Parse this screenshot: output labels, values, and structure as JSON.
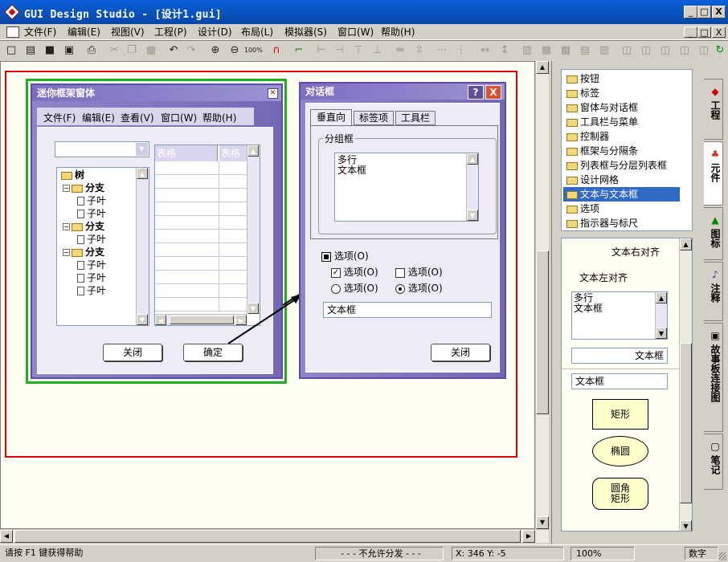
{
  "window": {
    "title": "GUI Design Studio - [设计1.gui]",
    "min": "_",
    "max": "□",
    "close": "X"
  },
  "menu": [
    "文件(F)",
    "编辑(E)",
    "视图(V)",
    "工程(P)",
    "设计(D)",
    "布局(L)",
    "模拟器(S)",
    "窗口(W)",
    "帮助(H)"
  ],
  "toolbar": {
    "zoom_label": "100%"
  },
  "mini_frame": {
    "title": "迷你框架窗体",
    "menu": [
      "文件(F)",
      "编辑(E)",
      "查看(V)",
      "窗口(W)",
      "帮助(H)"
    ],
    "combo": "组合框",
    "tree": [
      {
        "label": "树",
        "level": 0,
        "kind": "root"
      },
      {
        "label": "分支",
        "level": 1,
        "kind": "branch"
      },
      {
        "label": "子叶",
        "level": 2,
        "kind": "leaf"
      },
      {
        "label": "子叶",
        "level": 2,
        "kind": "leaf"
      },
      {
        "label": "分支",
        "level": 1,
        "kind": "branch"
      },
      {
        "label": "子叶",
        "level": 2,
        "kind": "leaf"
      },
      {
        "label": "分支",
        "level": 1,
        "kind": "branch"
      },
      {
        "label": "子叶",
        "level": 2,
        "kind": "leaf"
      },
      {
        "label": "子叶",
        "level": 2,
        "kind": "leaf"
      },
      {
        "label": "子叶",
        "level": 2,
        "kind": "leaf"
      }
    ],
    "table_headers": [
      "表格",
      "表格"
    ],
    "close_btn": "关闭",
    "ok_btn": "确定"
  },
  "dialog": {
    "title": "对话框",
    "help": "?",
    "close": "X",
    "tabs": [
      "垂直向",
      "标签项",
      "工具栏"
    ],
    "group_label": "分组框",
    "multiline": [
      "多行",
      "文本框"
    ],
    "option_main": "选项(O)",
    "check1": "选项(O)",
    "check2": "选项(O)",
    "radio1": "选项(O)",
    "radio2": "选项(O)",
    "textbox": "文本框",
    "close_btn": "关闭"
  },
  "components": [
    "按钮",
    "标签",
    "窗体与对话框",
    "工具栏与菜单",
    "控制器",
    "框架与分隔条",
    "列表框与分层列表框",
    "设计网格",
    "文本与文本框",
    "选项",
    "指示器与标尺"
  ],
  "selected_component": "文本与文本框",
  "preview": {
    "right_align": "文本右对齐",
    "left_align": "文本左对齐",
    "multiline": [
      "多行",
      "文本框"
    ],
    "textbox_right": "文本框",
    "textbox_left": "文本框",
    "rect": "矩形",
    "ellipse": "椭圆",
    "rounded": [
      "圆角",
      "矩形"
    ]
  },
  "side_tabs": [
    "工程",
    "元件",
    "图标",
    "注释",
    "故事板连接图",
    "笔记"
  ],
  "status": {
    "help": "请按 F1 键获得帮助",
    "dist": "- - - 不允许分发 - - -",
    "coords": "X: 346  Y: -5",
    "zoom": "100%",
    "mode": "数字"
  }
}
